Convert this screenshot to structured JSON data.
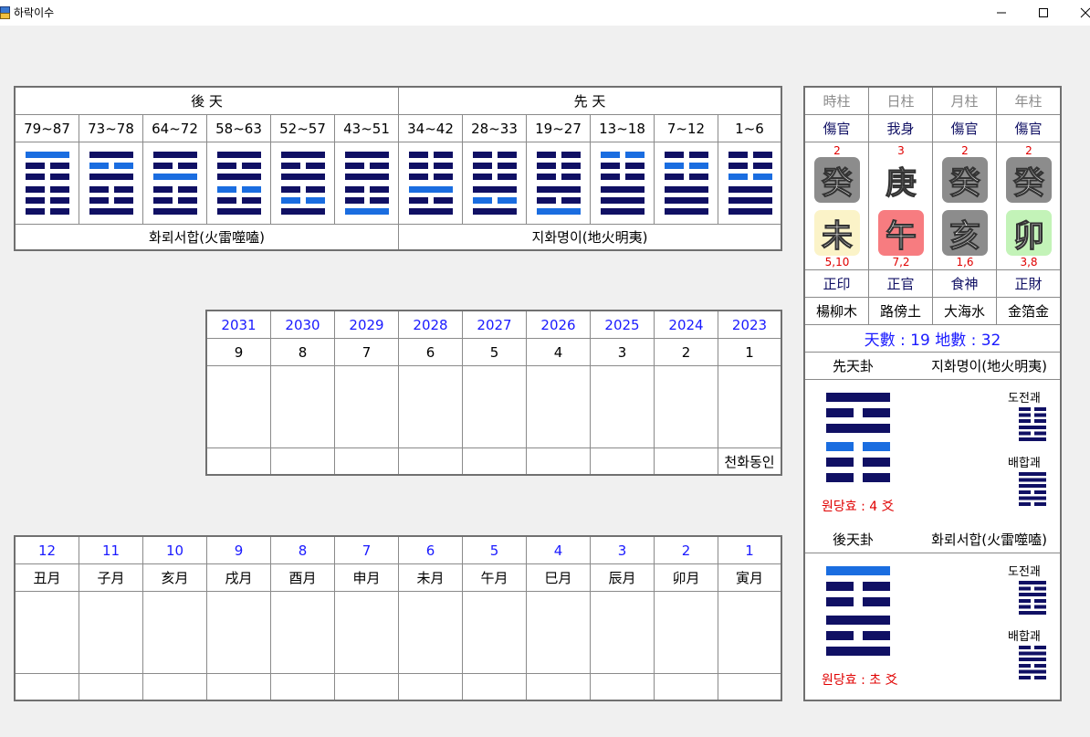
{
  "window": {
    "title": "하락이수"
  },
  "daewoon": {
    "header_left": "後 天",
    "header_right": "先 天",
    "ages": [
      "79~87",
      "73~78",
      "64~72",
      "58~63",
      "52~57",
      "43~51",
      "34~42",
      "28~33",
      "19~27",
      "13~18",
      "7~12",
      "1~6"
    ],
    "hexagrams": [
      {
        "lines": [
          1,
          0,
          0,
          0,
          0,
          0
        ],
        "hl": 0
      },
      {
        "lines": [
          1,
          0,
          1,
          0,
          0,
          1
        ],
        "hl": 1
      },
      {
        "lines": [
          1,
          0,
          1,
          0,
          0,
          1
        ],
        "hl": 2
      },
      {
        "lines": [
          1,
          0,
          1,
          0,
          0,
          1
        ],
        "hl": 3
      },
      {
        "lines": [
          1,
          0,
          1,
          0,
          0,
          1
        ],
        "hl": 4
      },
      {
        "lines": [
          1,
          0,
          1,
          0,
          0,
          1
        ],
        "hl": 5
      },
      {
        "lines": [
          0,
          0,
          0,
          1,
          0,
          1
        ],
        "hl": 3
      },
      {
        "lines": [
          0,
          0,
          0,
          1,
          0,
          1
        ],
        "hl": 4
      },
      {
        "lines": [
          0,
          0,
          0,
          1,
          0,
          1
        ],
        "hl": 5
      },
      {
        "lines": [
          0,
          0,
          0,
          1,
          1,
          1
        ],
        "hl": 0
      },
      {
        "lines": [
          0,
          0,
          0,
          1,
          1,
          1
        ],
        "hl": 1
      },
      {
        "lines": [
          0,
          0,
          0,
          1,
          1,
          1
        ],
        "hl": 2
      }
    ],
    "footer_left": "화뢰서합(火雷噬嗑)",
    "footer_right": "지화명이(地火明夷)"
  },
  "years": {
    "list": [
      "2031",
      "2030",
      "2029",
      "2028",
      "2027",
      "2026",
      "2025",
      "2024",
      "2023"
    ],
    "nums": [
      "9",
      "8",
      "7",
      "6",
      "5",
      "4",
      "3",
      "2",
      "1"
    ],
    "note": "천화동인"
  },
  "months": {
    "nums": [
      "12",
      "11",
      "10",
      "9",
      "8",
      "7",
      "6",
      "5",
      "4",
      "3",
      "2",
      "1"
    ],
    "names": [
      "丑月",
      "子月",
      "亥月",
      "戌月",
      "酉月",
      "申月",
      "未月",
      "午月",
      "巳月",
      "辰月",
      "卯月",
      "寅月"
    ]
  },
  "saju": {
    "pillars": [
      "時柱",
      "日柱",
      "月柱",
      "年柱"
    ],
    "sipsin_top": [
      "傷官",
      "我身",
      "傷官",
      "傷官"
    ],
    "stem_nums": [
      "2",
      "3",
      "2",
      "2"
    ],
    "stems": [
      "癸",
      "庚",
      "癸",
      "癸"
    ],
    "stem_colors": [
      "#8c8c8c",
      "#ffffff",
      "#8c8c8c",
      "#8c8c8c"
    ],
    "branches": [
      "未",
      "午",
      "亥",
      "卯"
    ],
    "branch_colors": [
      "#fbf3c8",
      "#f77c80",
      "#8c8c8c",
      "#c3f3b8"
    ],
    "branch_nums": [
      "5,10",
      "7,2",
      "1,6",
      "3,8"
    ],
    "sipsin_bottom": [
      "正印",
      "正官",
      "食神",
      "正財"
    ],
    "napeum": [
      "楊柳木",
      "路傍土",
      "大海水",
      "金箔金"
    ],
    "tian_di": "天數 : 19   地數 : 32"
  },
  "seoncheon": {
    "label": "先天卦",
    "name": "지화명이(地火明夷)",
    "main": {
      "lines": [
        1,
        0,
        1,
        0,
        0,
        0
      ],
      "hl": 3
    },
    "dojeon_label": "도전괘",
    "dojeon": {
      "lines": [
        0,
        0,
        0,
        1,
        0,
        1
      ]
    },
    "baehap_label": "배합괘",
    "baehap": {
      "lines": [
        1,
        1,
        1,
        0,
        1,
        0
      ]
    },
    "wondang": "원당효 : 4 爻"
  },
  "hucheon": {
    "label": "後天卦",
    "name": "화뢰서합(火雷噬嗑)",
    "main": {
      "lines": [
        1,
        0,
        0,
        1,
        0,
        1
      ],
      "hl": 0
    },
    "dojeon_label": "도전괘",
    "dojeon": {
      "lines": [
        1,
        0,
        1,
        0,
        0,
        1
      ]
    },
    "baehap_label": "배합괘",
    "baehap": {
      "lines": [
        0,
        1,
        1,
        0,
        1,
        0
      ]
    },
    "wondang": "원당효 : 초 爻"
  },
  "colors": {
    "line_navy": "#101064",
    "line_blue": "#1a6de0",
    "label_blue": "#1a1aff",
    "label_red": "#e00000"
  }
}
